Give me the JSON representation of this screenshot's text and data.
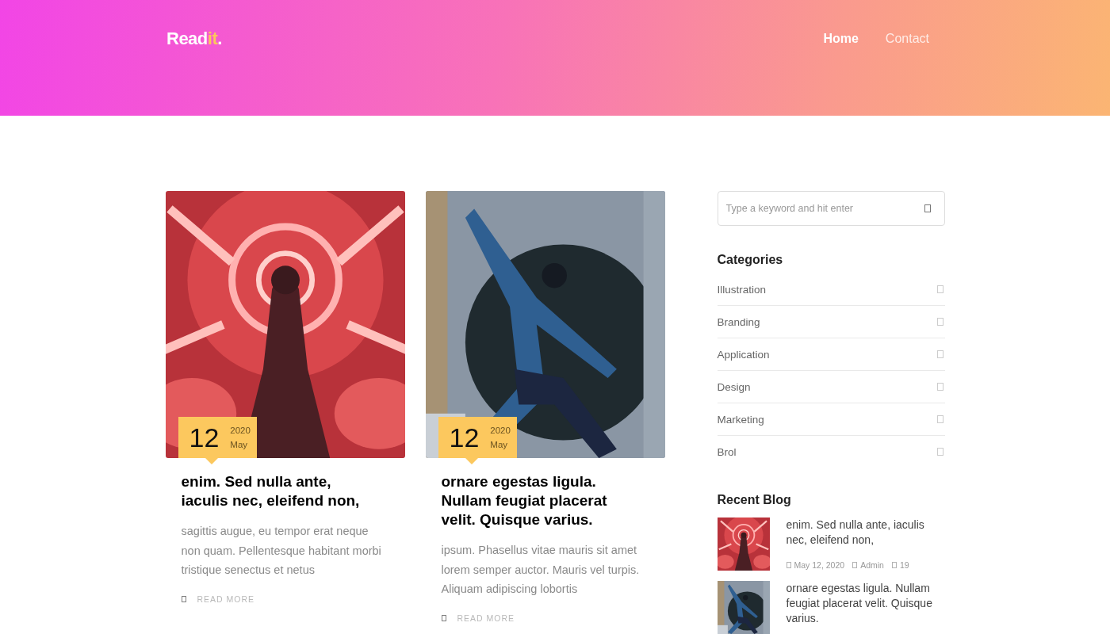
{
  "header": {
    "logo": [
      {
        "text": "Read",
        "accent": false
      },
      {
        "text": "it",
        "accent": true
      },
      {
        "text": ".",
        "accent": false
      }
    ],
    "nav": [
      {
        "label": "Home",
        "selected": true
      },
      {
        "label": "Contact",
        "selected": false
      }
    ]
  },
  "posts": [
    {
      "day": "12",
      "year": "2020",
      "month": "May",
      "title": "enim. Sed nulla ante, iaculis nec, eleifend non,",
      "excerpt": "sagittis augue, eu tempor erat neque non quam. Pellentesque habitant morbi tristique senectus et netus",
      "link": "READ MORE"
    },
    {
      "day": "12",
      "year": "2020",
      "month": "May",
      "title": "ornare egestas ligula. Nullam feugiat placerat velit. Quisque varius.",
      "excerpt": "ipsum. Phasellus vitae mauris sit amet lorem semper auctor. Mauris vel turpis. Aliquam adipiscing lobortis",
      "link": "READ MORE"
    }
  ],
  "sidebar": {
    "search": {
      "placeholder": "Type a keyword and hit enter"
    },
    "categories_title": "Categories",
    "categories": [
      "Illustration",
      "Branding",
      "Application",
      "Design",
      "Marketing",
      "Brol"
    ],
    "recent_title": "Recent Blog",
    "recent": [
      {
        "title": "enim. Sed nulla ante, iaculis nec, eleifend non,",
        "date": "May 12, 2020",
        "author": "Admin",
        "comments": "19"
      },
      {
        "title": "ornare egestas ligula. Nullam feugiat placerat velit. Quisque varius."
      }
    ]
  }
}
